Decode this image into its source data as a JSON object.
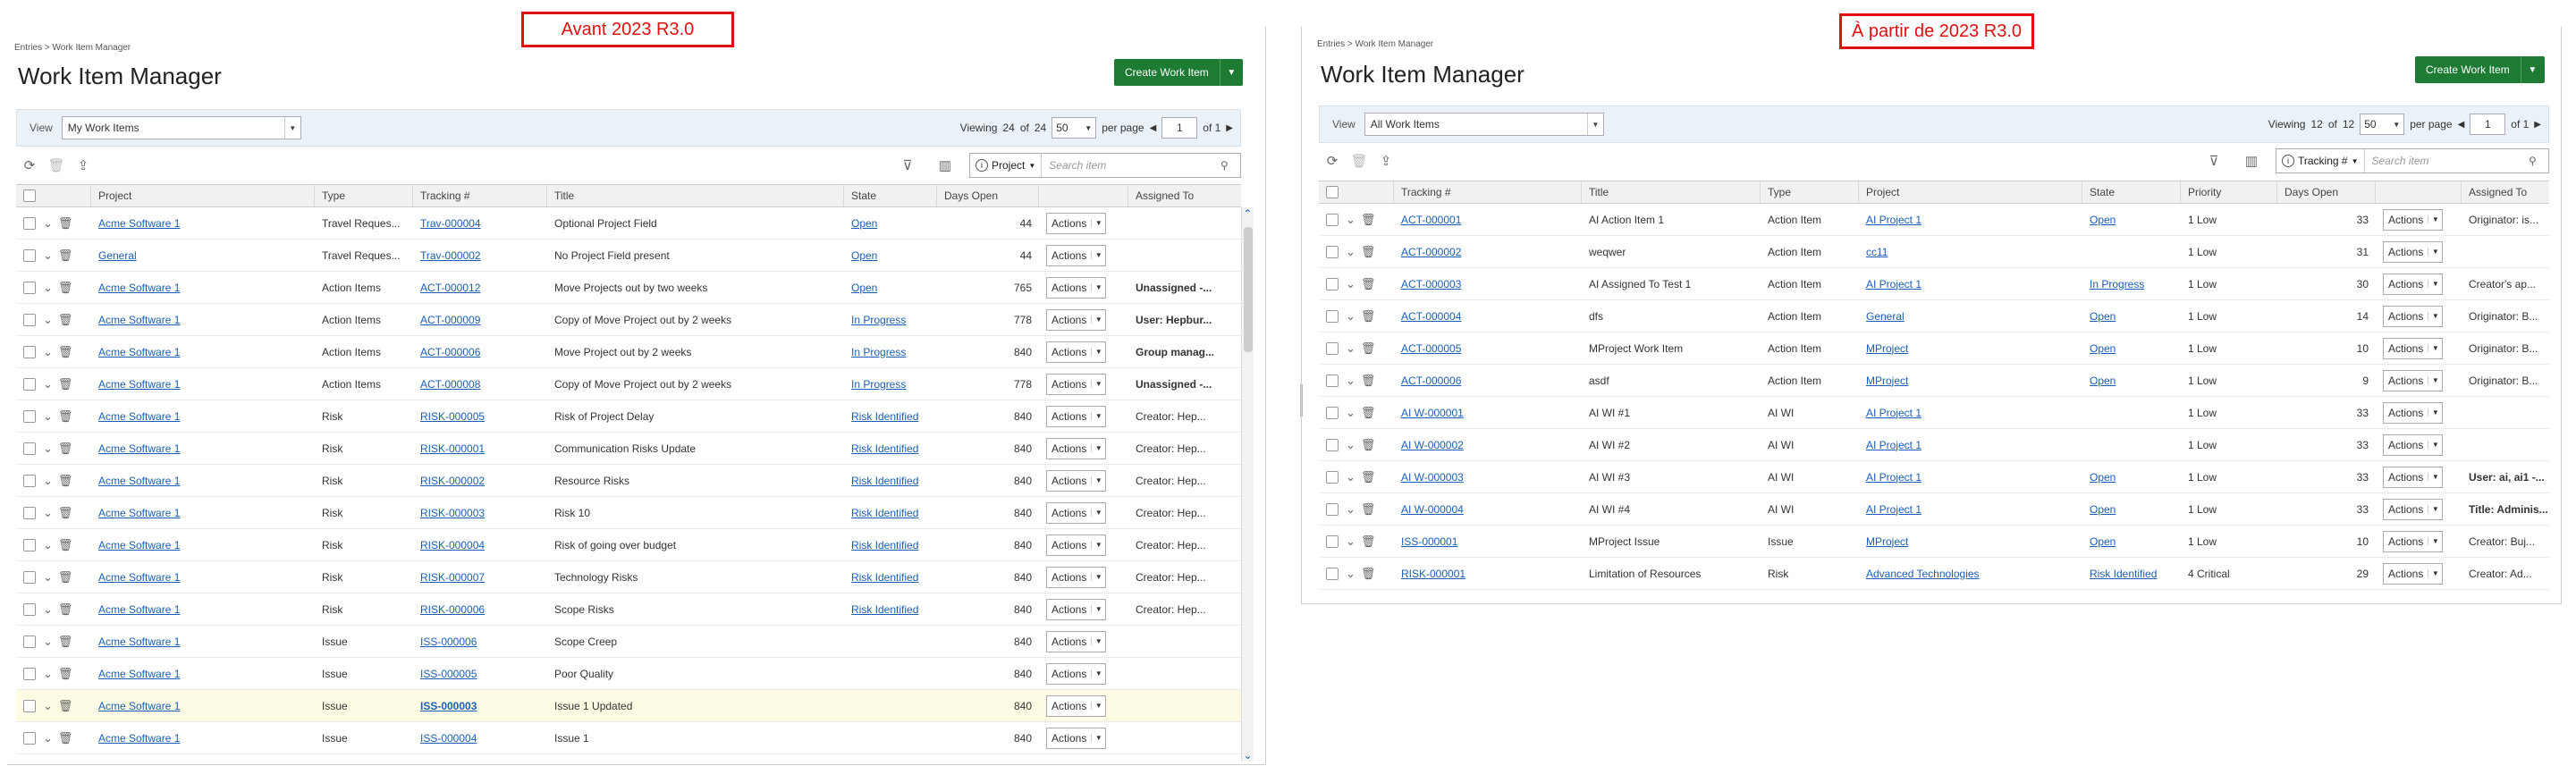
{
  "left": {
    "banner": "Avant 2023 R3.0",
    "breadcrumb": "Entries > Work Item Manager",
    "title": "Work Item Manager",
    "create_label": "Create Work Item",
    "view_label": "View",
    "view_value": "My Work Items",
    "viewing_prefix": "Viewing",
    "viewing_count": "24",
    "viewing_of": "of",
    "viewing_total": "24",
    "per_page_value": "50",
    "per_page_label": "per page",
    "page": "1",
    "page_of": "of 1",
    "search_scope": "Project",
    "search_placeholder": "Search item",
    "headers": {
      "project": "Project",
      "type": "Type",
      "tracking": "Tracking #",
      "title": "Title",
      "state": "State",
      "days": "Days Open",
      "assigned": "Assigned To"
    },
    "actions_label": "Actions",
    "rows": [
      {
        "project": "Acme Software 1",
        "type": "Travel Reques...",
        "tracking": "Trav-000004",
        "title": "Optional Project Field",
        "state": "Open",
        "days": "44",
        "assigned": ""
      },
      {
        "project": "General",
        "type": "Travel Reques...",
        "tracking": "Trav-000002",
        "title": "No Project Field present",
        "state": "Open",
        "days": "44",
        "assigned": ""
      },
      {
        "project": "Acme Software 1",
        "type": "Action Items",
        "tracking": "ACT-000012",
        "title": "Move Projects out by two weeks",
        "state": "Open",
        "days": "765",
        "assigned": "Unassigned -..."
      },
      {
        "project": "Acme Software 1",
        "type": "Action Items",
        "tracking": "ACT-000009",
        "title": "Copy of Move Project out by 2 weeks",
        "state": "In Progress",
        "days": "778",
        "assigned": "User: Hepbur..."
      },
      {
        "project": "Acme Software 1",
        "type": "Action Items",
        "tracking": "ACT-000006",
        "title": "Move Project out by 2 weeks",
        "state": "In Progress",
        "days": "840",
        "assigned": "Group manag..."
      },
      {
        "project": "Acme Software 1",
        "type": "Action Items",
        "tracking": "ACT-000008",
        "title": "Copy of Move Project out by 2 weeks",
        "state": "In Progress",
        "days": "778",
        "assigned": "Unassigned -..."
      },
      {
        "project": "Acme Software 1",
        "type": "Risk",
        "tracking": "RISK-000005",
        "title": "Risk of Project Delay",
        "state": "Risk Identified",
        "days": "840",
        "assigned": "Creator: Hep..."
      },
      {
        "project": "Acme Software 1",
        "type": "Risk",
        "tracking": "RISK-000001",
        "title": "Communication Risks Update",
        "state": "Risk Identified",
        "days": "840",
        "assigned": "Creator: Hep..."
      },
      {
        "project": "Acme Software 1",
        "type": "Risk",
        "tracking": "RISK-000002",
        "title": "Resource Risks",
        "state": "Risk Identified",
        "days": "840",
        "assigned": "Creator: Hep..."
      },
      {
        "project": "Acme Software 1",
        "type": "Risk",
        "tracking": "RISK-000003",
        "title": "Risk 10",
        "state": "Risk Identified",
        "days": "840",
        "assigned": "Creator: Hep..."
      },
      {
        "project": "Acme Software 1",
        "type": "Risk",
        "tracking": "RISK-000004",
        "title": "Risk of going over budget",
        "state": "Risk Identified",
        "days": "840",
        "assigned": "Creator: Hep..."
      },
      {
        "project": "Acme Software 1",
        "type": "Risk",
        "tracking": "RISK-000007",
        "title": "Technology Risks",
        "state": "Risk Identified",
        "days": "840",
        "assigned": "Creator: Hep..."
      },
      {
        "project": "Acme Software 1",
        "type": "Risk",
        "tracking": "RISK-000006",
        "title": "Scope Risks",
        "state": "Risk Identified",
        "days": "840",
        "assigned": "Creator: Hep..."
      },
      {
        "project": "Acme Software 1",
        "type": "Issue",
        "tracking": "ISS-000006",
        "title": "Scope Creep",
        "state": "",
        "days": "840",
        "assigned": ""
      },
      {
        "project": "Acme Software 1",
        "type": "Issue",
        "tracking": "ISS-000005",
        "title": "Poor Quality",
        "state": "",
        "days": "840",
        "assigned": ""
      },
      {
        "project": "Acme Software 1",
        "type": "Issue",
        "tracking": "ISS-000003",
        "title": "Issue 1 Updated",
        "state": "",
        "days": "840",
        "assigned": ""
      },
      {
        "project": "Acme Software 1",
        "type": "Issue",
        "tracking": "ISS-000004",
        "title": "Issue 1",
        "state": "",
        "days": "840",
        "assigned": ""
      }
    ]
  },
  "right": {
    "banner": "À partir de 2023 R3.0",
    "breadcrumb": "Entries > Work Item Manager",
    "title": "Work Item Manager",
    "create_label": "Create Work Item",
    "view_label": "View",
    "view_value": "All Work Items",
    "viewing_prefix": "Viewing",
    "viewing_count": "12",
    "viewing_of": "of",
    "viewing_total": "12",
    "per_page_value": "50",
    "per_page_label": "per page",
    "page": "1",
    "page_of": "of 1",
    "search_scope": "Tracking #",
    "search_placeholder": "Search item",
    "headers": {
      "tracking": "Tracking #",
      "title": "Title",
      "type": "Type",
      "project": "Project",
      "state": "State",
      "priority": "Priority",
      "days": "Days Open",
      "assigned": "Assigned To"
    },
    "actions_label": "Actions",
    "rows": [
      {
        "tracking": "ACT-000001",
        "title": "AI Action Item 1",
        "type": "Action Item",
        "project": "AI Project 1",
        "state": "Open",
        "priority": "1 Low",
        "days": "33",
        "assigned": "Originator: is..."
      },
      {
        "tracking": "ACT-000002",
        "title": "weqwer",
        "type": "Action Item",
        "project": "cc11",
        "state": "",
        "priority": "1 Low",
        "days": "31",
        "assigned": ""
      },
      {
        "tracking": "ACT-000003",
        "title": "AI Assigned To Test 1",
        "type": "Action Item",
        "project": "AI Project 1",
        "state": "In Progress",
        "priority": "1 Low",
        "days": "30",
        "assigned": "Creator's ap..."
      },
      {
        "tracking": "ACT-000004",
        "title": "dfs",
        "type": "Action Item",
        "project": "General",
        "state": "Open",
        "priority": "1 Low",
        "days": "14",
        "assigned": "Originator: B..."
      },
      {
        "tracking": "ACT-000005",
        "title": "MProject Work Item",
        "type": "Action Item",
        "project": "MProject",
        "state": "Open",
        "priority": "1 Low",
        "days": "10",
        "assigned": "Originator: B..."
      },
      {
        "tracking": "ACT-000006",
        "title": "asdf",
        "type": "Action Item",
        "project": "MProject",
        "state": "Open",
        "priority": "1 Low",
        "days": "9",
        "assigned": "Originator: B..."
      },
      {
        "tracking": "AI W-000001",
        "title": "AI WI #1",
        "type": "AI WI",
        "project": "AI Project 1",
        "state": "",
        "priority": "1 Low",
        "days": "33",
        "assigned": ""
      },
      {
        "tracking": "AI W-000002",
        "title": "AI WI #2",
        "type": "AI WI",
        "project": "AI Project 1",
        "state": "",
        "priority": "1 Low",
        "days": "33",
        "assigned": ""
      },
      {
        "tracking": "AI W-000003",
        "title": "AI WI #3",
        "type": "AI WI",
        "project": "AI Project 1",
        "state": "Open",
        "priority": "1 Low",
        "days": "33",
        "assigned": "User: ai, ai1 -..."
      },
      {
        "tracking": "AI W-000004",
        "title": "AI WI #4",
        "type": "AI WI",
        "project": "AI Project 1",
        "state": "Open",
        "priority": "1 Low",
        "days": "33",
        "assigned": "Title: Adminis..."
      },
      {
        "tracking": "ISS-000001",
        "title": "MProject Issue",
        "type": "Issue",
        "project": "MProject",
        "state": "Open",
        "priority": "1 Low",
        "days": "10",
        "assigned": "Creator: Buj..."
      },
      {
        "tracking": "RISK-000001",
        "title": "Limitation of Resources",
        "type": "Risk",
        "project": "Advanced Technologies",
        "state": "Risk Identified",
        "priority": "4 Critical",
        "days": "29",
        "assigned": "Creator: Ad..."
      }
    ]
  }
}
